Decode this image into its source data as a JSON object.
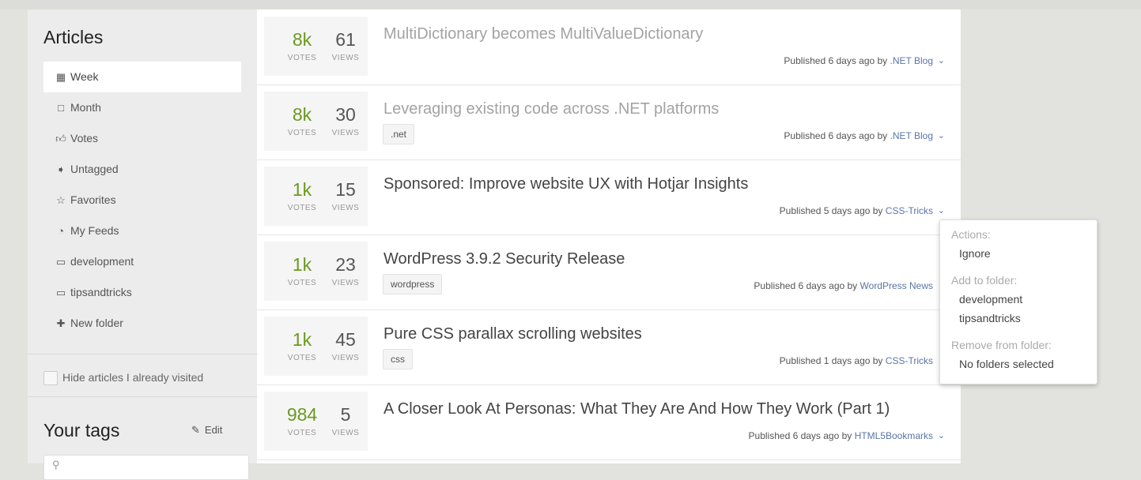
{
  "sidebar": {
    "heading": "Articles",
    "nav": [
      {
        "label": "Week",
        "icon": "calendar-icon"
      },
      {
        "label": "Month",
        "icon": "calendar-icon"
      },
      {
        "label": "Votes",
        "icon": "thumbs-up-icon"
      },
      {
        "label": "Untagged",
        "icon": "tags-icon"
      },
      {
        "label": "Favorites",
        "icon": "star-icon"
      },
      {
        "label": "My Feeds",
        "icon": "rss-icon"
      },
      {
        "label": "development",
        "icon": "folder-icon"
      },
      {
        "label": "tipsandtricks",
        "icon": "folder-icon"
      },
      {
        "label": "New folder",
        "icon": "plus-icon"
      }
    ],
    "active_item": "Week",
    "hide_visited_label": "Hide articles I already visited",
    "tags_heading": "Your tags",
    "tags_edit_label": "Edit"
  },
  "articles": [
    {
      "votes": "8k",
      "views": "61",
      "votes_label": "VOTES",
      "views_label": "VIEWS",
      "title": "MultiDictionary becomes MultiValueDictionary",
      "visited": true,
      "tag": "",
      "published": "Published 6 days ago by",
      "source": ".NET Blog"
    },
    {
      "votes": "8k",
      "views": "30",
      "votes_label": "VOTES",
      "views_label": "VIEWS",
      "title": "Leveraging existing code across .NET platforms",
      "visited": true,
      "tag": ".net",
      "published": "Published 6 days ago by",
      "source": ".NET Blog"
    },
    {
      "votes": "1k",
      "views": "15",
      "votes_label": "VOTES",
      "views_label": "VIEWS",
      "title": "Sponsored: Improve website UX with Hotjar Insights",
      "visited": false,
      "tag": "",
      "published": "Published 5 days ago by",
      "source": "CSS-Tricks"
    },
    {
      "votes": "1k",
      "views": "23",
      "votes_label": "VOTES",
      "views_label": "VIEWS",
      "title": "WordPress 3.9.2 Security Release",
      "visited": false,
      "tag": "wordpress",
      "published": "Published 6 days ago by",
      "source": "WordPress News"
    },
    {
      "votes": "1k",
      "views": "45",
      "votes_label": "VOTES",
      "views_label": "VIEWS",
      "title": "Pure CSS parallax scrolling websites",
      "visited": false,
      "tag": "css",
      "published": "Published 1 days ago by",
      "source": "CSS-Tricks"
    },
    {
      "votes": "984",
      "views": "5",
      "votes_label": "VOTES",
      "views_label": "VIEWS",
      "title": "A Closer Look At Personas: What They Are And How They Work (Part 1)",
      "visited": false,
      "tag": "",
      "published": "Published 6 days ago by",
      "source": "HTML5Bookmarks"
    }
  ],
  "popup": {
    "actions_heading": "Actions:",
    "ignore_label": "Ignore",
    "add_heading": "Add to folder:",
    "folders": [
      "development",
      "tipsandtricks"
    ],
    "remove_heading": "Remove from folder:",
    "no_folders_label": "No folders selected"
  },
  "colors": {
    "votes_green": "#6a9a1f",
    "source_link": "#5a75a8",
    "visited_title": "#a3a3a3"
  }
}
